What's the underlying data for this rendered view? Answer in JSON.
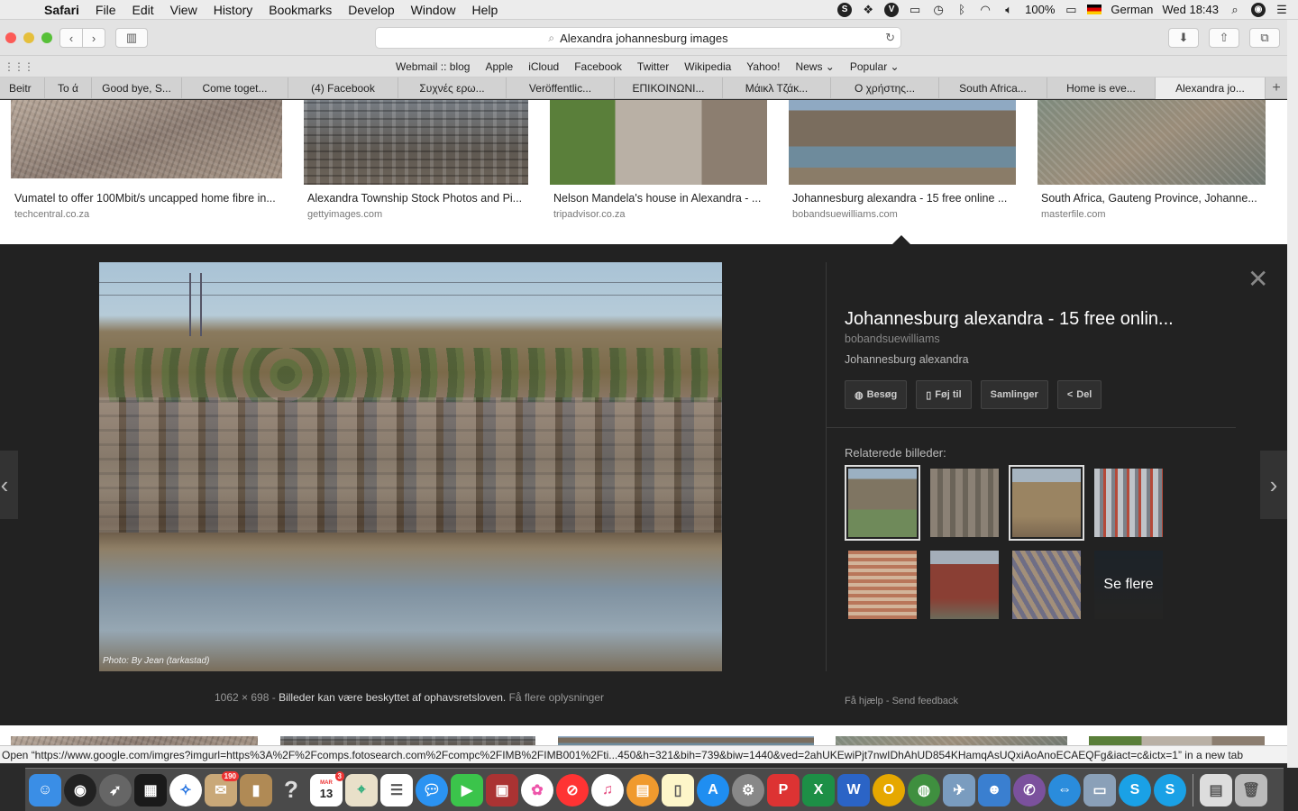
{
  "menubar": {
    "app_name": "Safari",
    "menus": [
      "File",
      "Edit",
      "View",
      "History",
      "Bookmarks",
      "Develop",
      "Window",
      "Help"
    ],
    "battery": "100%",
    "input_source": "German",
    "clock": "Wed 18:43"
  },
  "toolbar": {
    "address": "Alexandra johannesburg images"
  },
  "favorites": [
    "Webmail :: blog",
    "Apple",
    "iCloud",
    "Facebook",
    "Twitter",
    "Wikipedia",
    "Yahoo!",
    "News ⌄",
    "Popular ⌄"
  ],
  "tabs": [
    "Beitr",
    "To ά",
    "Good bye, S...",
    "Come toget...",
    "(4) Facebook",
    "Συχνές ερω...",
    "Veröffentlic...",
    "ΕΠΙΚΟΙΝΩΝΙ...",
    "Μάικλ Τζάκ...",
    "Ο χρήστης...",
    "South Africa...",
    "Home is eve...",
    "Alexandra jo..."
  ],
  "results": [
    {
      "title": "Vumatel to offer 100Mbit/s uncapped home fibre in...",
      "domain": "techcentral.co.za"
    },
    {
      "title": "Alexandra Township Stock Photos and Pi...",
      "domain": "gettyimages.com"
    },
    {
      "title": "Nelson Mandela's house in Alexandra - ...",
      "domain": "tripadvisor.co.za"
    },
    {
      "title": "Johannesburg alexandra - 15 free online ...",
      "domain": "bobandsuewilliams.com"
    },
    {
      "title": "South Africa, Gauteng Province, Johanne...",
      "domain": "masterfile.com"
    }
  ],
  "viewer": {
    "image_credit": "Photo: By Jean (tarkastad)",
    "dimensions": "1062 × 698",
    "copyright_notice": "Billeder kan være beskyttet af ophavsretsloven.",
    "more_info_link": "Få flere oplysninger",
    "title": "Johannesburg alexandra - 15 free onlin...",
    "site": "bobandsuewilliams",
    "description": "Johannesburg alexandra",
    "actions": {
      "visit": "Besøg",
      "save": "Føj til",
      "collections": "Samlinger",
      "share": "Del"
    },
    "related_label": "Relaterede billeder:",
    "see_more": "Se flere",
    "help_link": "Få hjælp",
    "feedback_link": "Send feedback"
  },
  "statusbar": {
    "text": "Open “https://www.google.com/imgres?imgurl=https%3A%2F%2Fcomps.fotosearch.com%2Fcompc%2FIMB%2FIMB001%2Fti...450&h=321&bih=739&biw=1440&ved=2ahUKEwiPjt7nwIDhAhUD854KHamqAsUQxiAoAnoECAEQFg&iact=c&ictx=1” in a new tab"
  },
  "dock": {
    "calendar_month": "MAR",
    "calendar_day": "13",
    "mail_badge": "190",
    "calendar_badge": "3"
  }
}
